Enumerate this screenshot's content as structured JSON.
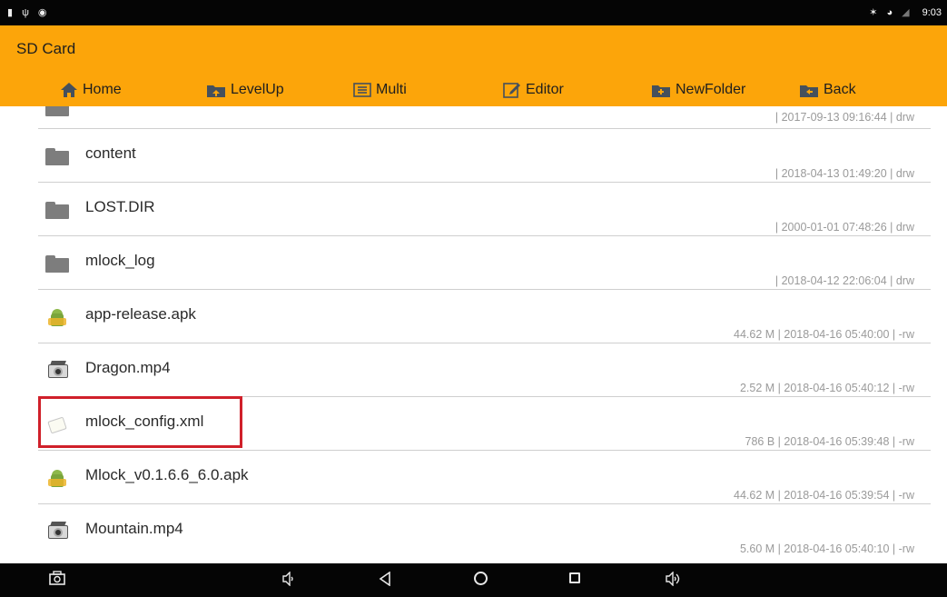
{
  "status_bar": {
    "time": "9:03",
    "left_icons": [
      "sd-card-icon",
      "usb-icon",
      "android-debug-icon"
    ],
    "right_icons": [
      "bluetooth-icon",
      "headset-icon",
      "no-signal-icon"
    ]
  },
  "header": {
    "title": "SD Card",
    "toolbar": [
      {
        "name": "home-button",
        "label": "Home",
        "icon": "home-icon"
      },
      {
        "name": "levelup-button",
        "label": "LevelUp",
        "icon": "level-up-icon"
      },
      {
        "name": "multi-button",
        "label": "Multi",
        "icon": "multi-select-icon"
      },
      {
        "name": "editor-button",
        "label": "Editor",
        "icon": "edit-icon"
      },
      {
        "name": "newfolder-button",
        "label": "NewFolder",
        "icon": "new-folder-icon"
      },
      {
        "name": "back-button",
        "label": "Back",
        "icon": "back-folder-icon"
      }
    ]
  },
  "files": [
    {
      "name": "",
      "meta": "| 2017-09-13 09:16:44 | drw",
      "type": "folder"
    },
    {
      "name": "content",
      "meta": "| 2018-04-13 01:49:20 | drw",
      "type": "folder"
    },
    {
      "name": "LOST.DIR",
      "meta": "| 2000-01-01 07:48:26 | drw",
      "type": "folder"
    },
    {
      "name": "mlock_log",
      "meta": "| 2018-04-12 22:06:04 | drw",
      "type": "folder"
    },
    {
      "name": "app-release.apk",
      "meta": "44.62 M | 2018-04-16 05:40:00 | -rw",
      "type": "apk"
    },
    {
      "name": "Dragon.mp4",
      "meta": "2.52 M | 2018-04-16 05:40:12 | -rw",
      "type": "video"
    },
    {
      "name": "mlock_config.xml",
      "meta": "786 B | 2018-04-16 05:39:48 | -rw",
      "type": "xml",
      "highlighted": true
    },
    {
      "name": "Mlock_v0.1.6.6_6.0.apk",
      "meta": "44.62 M | 2018-04-16 05:39:54 | -rw",
      "type": "apk"
    },
    {
      "name": "Mountain.mp4",
      "meta": "5.60 M | 2018-04-16 05:40:10 | -rw",
      "type": "video"
    }
  ],
  "nav_bar": {
    "buttons": [
      "screenshot-icon",
      "volume-down-icon",
      "back-icon",
      "home-circle-icon",
      "recents-icon",
      "volume-up-icon"
    ]
  },
  "colors": {
    "header": "#fca50a",
    "status_bar": "#050505",
    "highlight": "#d0202a"
  }
}
